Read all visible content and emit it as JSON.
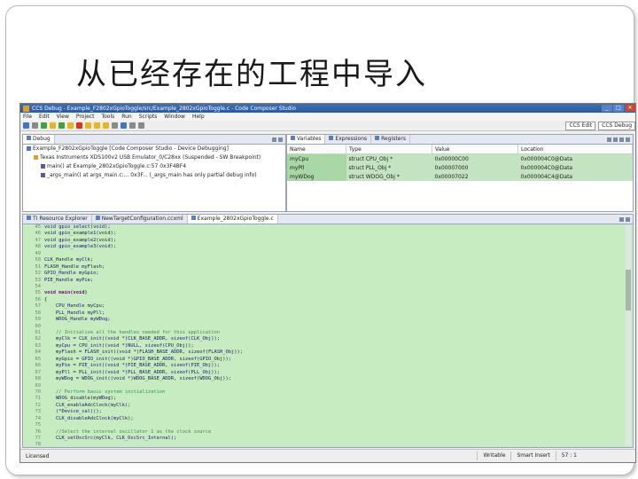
{
  "slide": {
    "title": "从已经存在的工程中导入"
  },
  "window": {
    "title": "CCS Debug - Example_F2802xGpioToggle/src/Example_2802xGpioToggle.c - Code Composer Studio"
  },
  "menu": [
    "File",
    "Edit",
    "View",
    "Project",
    "Tools",
    "Run",
    "Scripts",
    "Window",
    "Help"
  ],
  "perspective": {
    "quick_access": "CCS Edit",
    "active": "CCS Debug"
  },
  "debug_view": {
    "tab": "Debug",
    "rows": [
      "Example_F2802xGpioToggle [Code Composer Studio - Device Debugging]",
      "Texas Instruments XDS100v2 USB Emulator_0/C28xx (Suspended - SW Breakpoint)",
      "main() at Example_2802xGpioToggle.c:57 0x3F4BF4",
      "_args_main() at args_main.c:... 0x3F... (_args_main has only partial debug info)"
    ]
  },
  "variables_view": {
    "tabs": [
      "Variables",
      "Expressions",
      "Registers"
    ],
    "columns": [
      "Name",
      "Type",
      "Value",
      "Location"
    ],
    "rows": [
      {
        "name": "myCpu",
        "type": "struct CPU_Obj *",
        "value": "0x00000C00",
        "location": "0x000004C0@Data"
      },
      {
        "name": "myPll",
        "type": "struct PLL_Obj *",
        "value": "0x00007000",
        "location": "0x000004C0@Data"
      },
      {
        "name": "myWDog",
        "type": "struct WDOG_Obj *",
        "value": "0x00007022",
        "location": "0x000004C4@Data"
      }
    ]
  },
  "editor": {
    "tabs": [
      "TI Resource Explorer",
      "NewTargetConfiguration.ccxml",
      "Example_2802xGpioToggle.c"
    ],
    "lines": [
      {
        "n": "45",
        "t": "void gpio_select(void);",
        "k": ""
      },
      {
        "n": "46",
        "t": "void gpio_example1(void);",
        "k": ""
      },
      {
        "n": "47",
        "t": "void gpio_example2(void);",
        "k": ""
      },
      {
        "n": "48",
        "t": "void gpio_example3(void);",
        "k": ""
      },
      {
        "n": "49",
        "t": "",
        "k": ""
      },
      {
        "n": "50",
        "t": "CLK_Handle myClk;",
        "k": ""
      },
      {
        "n": "51",
        "t": "FLASH_Handle myFlash;",
        "k": ""
      },
      {
        "n": "52",
        "t": "GPIO_Handle myGpio;",
        "k": ""
      },
      {
        "n": "53",
        "t": "PIE_Handle myPie;",
        "k": ""
      },
      {
        "n": "54",
        "t": "",
        "k": ""
      },
      {
        "n": "55",
        "t": "void main(void)",
        "k": "kw"
      },
      {
        "n": "56",
        "t": "{",
        "k": ""
      },
      {
        "n": "57",
        "t": "    CPU_Handle myCpu;",
        "k": ""
      },
      {
        "n": "58",
        "t": "    PLL_Handle myPll;",
        "k": ""
      },
      {
        "n": "59",
        "t": "    WDOG_Handle myWDog;",
        "k": ""
      },
      {
        "n": "60",
        "t": "",
        "k": ""
      },
      {
        "n": "61",
        "t": "    // Initialize all the handles needed for this application",
        "k": "cm"
      },
      {
        "n": "62",
        "t": "    myClk = CLK_init((void *)CLK_BASE_ADDR, sizeof(CLK_Obj));",
        "k": ""
      },
      {
        "n": "63",
        "t": "    myCpu = CPU_init((void *)NULL, sizeof(CPU_Obj));",
        "k": ""
      },
      {
        "n": "64",
        "t": "    myFlash = FLASH_init((void *)FLASH_BASE_ADDR, sizeof(FLASH_Obj));",
        "k": ""
      },
      {
        "n": "65",
        "t": "    myGpio = GPIO_init((void *)GPIO_BASE_ADDR, sizeof(GPIO_Obj));",
        "k": ""
      },
      {
        "n": "66",
        "t": "    myPie = PIE_init((void *)PIE_BASE_ADDR, sizeof(PIE_Obj));",
        "k": ""
      },
      {
        "n": "67",
        "t": "    myPll = PLL_init((void *)PLL_BASE_ADDR, sizeof(PLL_Obj));",
        "k": ""
      },
      {
        "n": "68",
        "t": "    myWDog = WDOG_init((void *)WDOG_BASE_ADDR, sizeof(WDOG_Obj));",
        "k": ""
      },
      {
        "n": "69",
        "t": "",
        "k": ""
      },
      {
        "n": "70",
        "t": "    // Perform basic system initialization",
        "k": "cm"
      },
      {
        "n": "71",
        "t": "    WDOG_disable(myWDog);",
        "k": ""
      },
      {
        "n": "72",
        "t": "    CLK_enableAdcClock(myClk);",
        "k": ""
      },
      {
        "n": "73",
        "t": "    (*Device_cal)();",
        "k": ""
      },
      {
        "n": "74",
        "t": "    CLK_disableAdcClock(myClk);",
        "k": ""
      },
      {
        "n": "75",
        "t": "",
        "k": ""
      },
      {
        "n": "76",
        "t": "    //Select the internal oscillator 1 as the clock source",
        "k": "cm"
      },
      {
        "n": "77",
        "t": "    CLK_setOscSrc(myClk, CLK_OscSrc_Internal);",
        "k": ""
      },
      {
        "n": "78",
        "t": "",
        "k": ""
      }
    ]
  },
  "status": {
    "license": "Licensed",
    "writable": "Writable",
    "insert_mode": "Smart Insert",
    "position": "57 : 1"
  }
}
